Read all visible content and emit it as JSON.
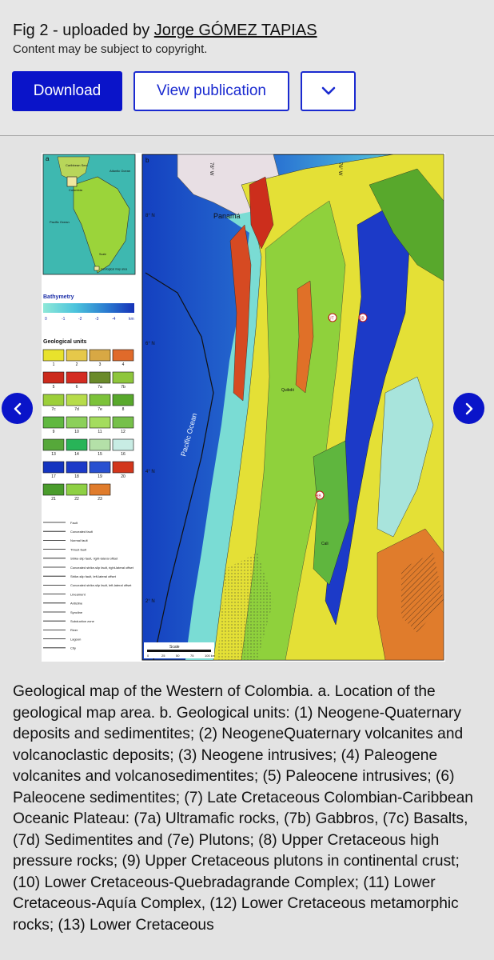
{
  "header": {
    "fig_prefix": "Fig 2 - uploaded by ",
    "uploader": "Jorge GÓMEZ TAPIAS",
    "copyright": "Content may be subject to copyright."
  },
  "actions": {
    "download_label": "Download",
    "view_publication_label": "View publication",
    "more_icon": "chevron-down-icon"
  },
  "figure": {
    "panel_a_label": "a",
    "panel_b_label": "b",
    "inset_labels": [
      "Caribbean Sea",
      "Atlantic Ocean",
      "Colombia",
      "Pacific Ocean"
    ],
    "inset_scale_text": "Scale",
    "inset_geo_area": "Geological map area",
    "bathymetry_title": "Bathymetry",
    "bathymetry_ticks": [
      "0",
      "-1",
      "-2",
      "-3",
      "-4",
      "km"
    ],
    "units_title": "Geological units",
    "units": [
      {
        "label": "1",
        "color": "#e8e22c"
      },
      {
        "label": "2",
        "color": "#e6c84a"
      },
      {
        "label": "3",
        "color": "#d8a844"
      },
      {
        "label": "4",
        "color": "#e06a2a"
      },
      {
        "label": "5",
        "color": "#cc2a1c"
      },
      {
        "label": "6",
        "color": "#d42c22"
      },
      {
        "label": "7a",
        "color": "#6a8a2a"
      },
      {
        "label": "7b",
        "color": "#8ec63c"
      },
      {
        "label": "7c",
        "color": "#9ccf3a"
      },
      {
        "label": "7d",
        "color": "#b6dc4a"
      },
      {
        "label": "7e",
        "color": "#7cc23a"
      },
      {
        "label": "8",
        "color": "#58a82c"
      },
      {
        "label": "9",
        "color": "#60b840"
      },
      {
        "label": "10",
        "color": "#8cd05a"
      },
      {
        "label": "11",
        "color": "#a4dc5e"
      },
      {
        "label": "12",
        "color": "#76c04a"
      },
      {
        "label": "13",
        "color": "#56a83a"
      },
      {
        "label": "14",
        "color": "#28b458"
      },
      {
        "label": "15",
        "color": "#b4e0a8"
      },
      {
        "label": "16",
        "color": "#c8ece4"
      },
      {
        "label": "17",
        "color": "#1434c0"
      },
      {
        "label": "18",
        "color": "#1c3ac8"
      },
      {
        "label": "19",
        "color": "#2850d0"
      },
      {
        "label": "20",
        "color": "#d2361c"
      },
      {
        "label": "21",
        "color": "#4a9c2c"
      },
      {
        "label": "22",
        "color": "#8ed044"
      },
      {
        "label": "23",
        "color": "#e07c2c"
      }
    ],
    "legend_lines": [
      "Fault",
      "Concealed fault",
      "Normal fault",
      "Thrust fault",
      "Strike-slip fault, right-lateral offset",
      "Concealed strike-slip fault, right-lateral offset",
      "Strike-slip fault, left-lateral offset",
      "Concealed strike-slip fault, left-lateral offset",
      "Lineament",
      "Anticline",
      "Syncline",
      "Subduction zone",
      "River",
      "Lagoon",
      "City"
    ],
    "map_labels": {
      "panama": "Panamá",
      "pacific": "Pacific Ocean",
      "lat_8": "8° N",
      "lat_6": "6° N",
      "lat_4": "4° N",
      "lat_2": "2° N",
      "lon_78": "78° W",
      "lon_76": "76° W",
      "quibdo": "Quibdó",
      "cali": "Cali",
      "scale": "Scale",
      "scale_ticks": [
        "0",
        "25",
        "50",
        "75",
        "100 km"
      ],
      "ut": "UT",
      "sb": "SB",
      "bb": "BB"
    }
  },
  "navigation": {
    "prev_icon": "chevron-left-icon",
    "next_icon": "chevron-right-icon"
  },
  "caption": "Geological map of the Western of Colombia. a. Location of the geological map area. b. Geological units: (1) Neogene-Quaternary deposits and sedimentites; (2) NeogeneQuaternary volcanites and volcanoclastic deposits; (3) Neogene intrusives; (4) Paleogene volcanites and volcanosedimentites; (5) Paleocene intrusives; (6) Paleocene sedimentites; (7) Late Cretaceous Colombian-Caribbean Oceanic Plateau: (7a) Ultramafic rocks, (7b) Gabbros, (7c) Basalts, (7d) Sedimentites and (7e) Plutons; (8) Upper Cretaceous high pressure rocks; (9) Upper Cretaceous plutons in continental crust; (10) Lower Cretaceous-Quebradagrande Complex; (11) Lower Cretaceous-Aquía Complex, (12) Lower Cretaceous metamorphic rocks; (13) Lower Cretaceous"
}
